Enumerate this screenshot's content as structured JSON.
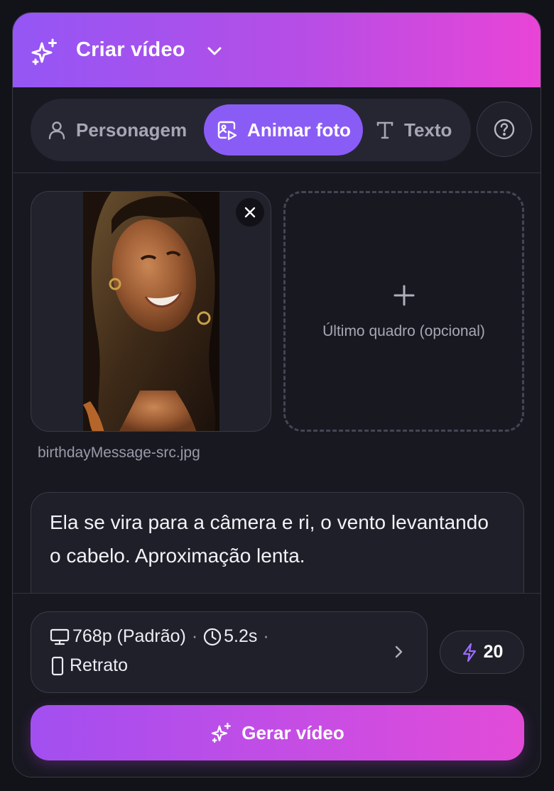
{
  "colors": {
    "accent": "#8a5cf6",
    "gradient_start": "#9456f5",
    "gradient_end": "#e944d6",
    "panel_bg": "#181821"
  },
  "header": {
    "title": "Criar vídeo",
    "icon": "sparkles-icon",
    "dropdown_icon": "chevron-down-icon"
  },
  "tabs": [
    {
      "label": "Personagem",
      "icon": "person-icon",
      "active": false
    },
    {
      "label": "Animar foto",
      "icon": "image-play-icon",
      "active": true
    },
    {
      "label": "Texto",
      "icon": "text-t-icon",
      "active": false
    }
  ],
  "help": {
    "icon": "question-circle-icon"
  },
  "upload": {
    "first_frame_filename": "birthdayMessage-src.jpg",
    "remove_icon": "close-icon",
    "last_frame_hint": "Último quadro (opcional)",
    "add_icon": "plus-icon"
  },
  "prompt": {
    "text": "Ela se vira para a câmera e ri, o vento levantando o cabelo. Aproximação lenta."
  },
  "settings": {
    "resolution": "768p (Padrão)",
    "separator": "·",
    "duration": "5.2s",
    "orientation": "Retrato",
    "resolution_icon": "monitor-icon",
    "duration_icon": "clock-icon",
    "orientation_icon": "phone-portrait-icon",
    "open_icon": "chevron-right-icon"
  },
  "credits": {
    "value": "20",
    "icon": "lightning-icon"
  },
  "generate": {
    "label": "Gerar vídeo",
    "icon": "sparkles-icon"
  }
}
